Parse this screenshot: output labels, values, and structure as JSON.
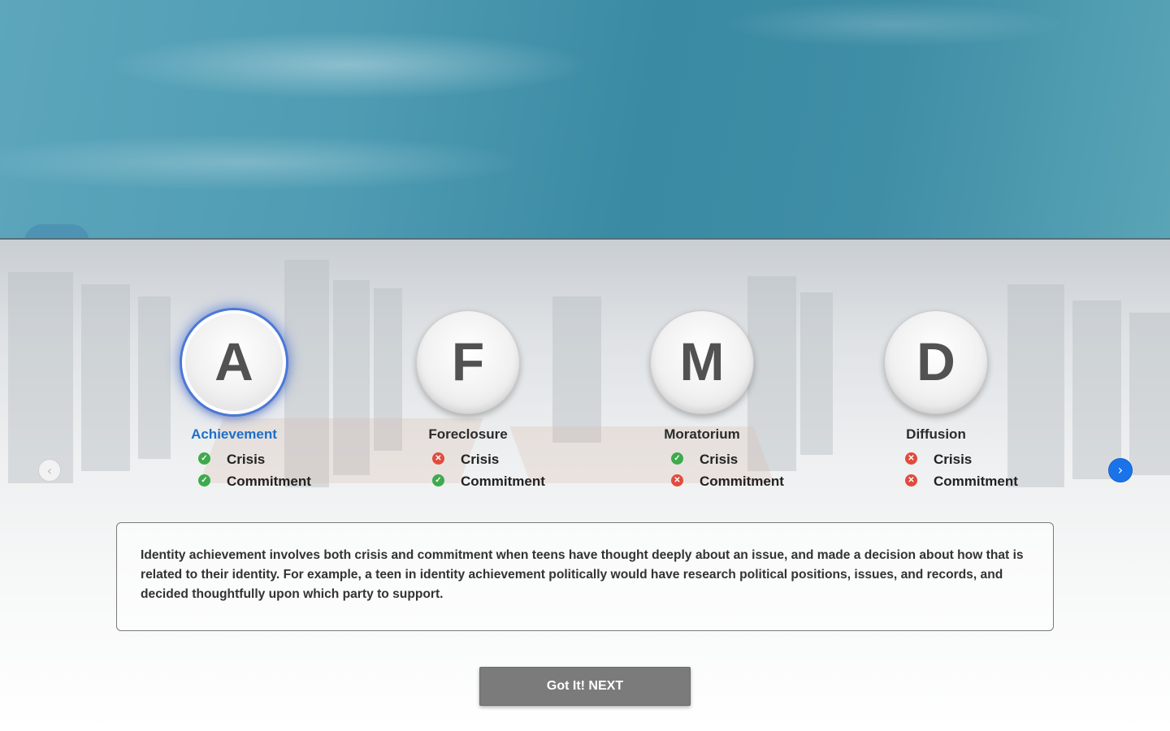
{
  "statuses": [
    {
      "letter": "A",
      "title": "Achievement",
      "active": true,
      "criteria": [
        {
          "label": "Crisis",
          "status": "check-icon"
        },
        {
          "label": "Commitment",
          "status": "check-icon"
        }
      ]
    },
    {
      "letter": "F",
      "title": "Foreclosure",
      "active": false,
      "criteria": [
        {
          "label": "Crisis",
          "status": "x-icon"
        },
        {
          "label": "Commitment",
          "status": "check-icon"
        }
      ]
    },
    {
      "letter": "M",
      "title": "Moratorium",
      "active": false,
      "criteria": [
        {
          "label": "Crisis",
          "status": "check-icon"
        },
        {
          "label": "Commitment",
          "status": "x-icon"
        }
      ]
    },
    {
      "letter": "D",
      "title": "Diffusion",
      "active": false,
      "criteria": [
        {
          "label": "Crisis",
          "status": "x-icon"
        },
        {
          "label": "Commitment",
          "status": "x-icon"
        }
      ]
    }
  ],
  "navigation": {
    "prev_icon": "chevron-left-icon",
    "prev_glyph": "‹",
    "next_icon": "chevron-right-icon",
    "next_glyph": "›"
  },
  "description": "Identity achievement involves both crisis and commitment when teens have thought deeply about an issue, and made a decision about how that is related to their identity. For example, a teen in identity achievement politically would have research political positions, issues, and records, and decided thoughtfully upon which party to support.",
  "next_button_label": "Got It! NEXT",
  "colors": {
    "accent": "#1d6fc9",
    "check": "#3daa4c",
    "cross": "#e14b3d",
    "button": "#7b7b7b"
  }
}
